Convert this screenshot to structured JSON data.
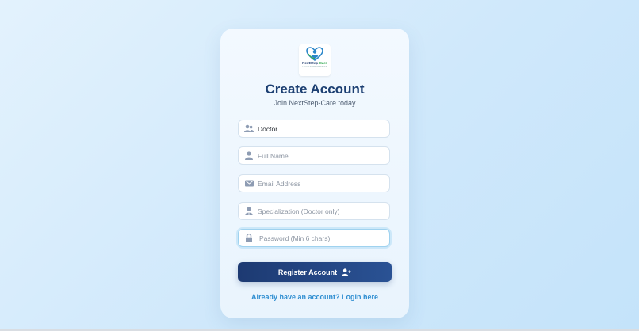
{
  "logo": {
    "brand_main": "NextStep",
    "brand_accent": "-Care",
    "tagline": "HEALTHCARE SERVICES",
    "icon": "heart-hands-icon"
  },
  "header": {
    "title": "Create Account",
    "subtitle": "Join NextStep-Care today"
  },
  "form": {
    "role": {
      "value": "Doctor",
      "icon": "users-icon"
    },
    "full_name": {
      "placeholder": "Full Name",
      "icon": "user-icon"
    },
    "email": {
      "placeholder": "Email Address",
      "icon": "envelope-icon"
    },
    "specialization": {
      "placeholder": "Specialization (Doctor only)",
      "icon": "user-doctor-icon"
    },
    "password": {
      "placeholder": "Password (Min 6 chars)",
      "icon": "lock-icon"
    }
  },
  "actions": {
    "register_label": "Register Account",
    "register_icon": "user-plus-icon",
    "login_link": "Already have an account? Login here"
  },
  "colors": {
    "primary": "#1d3a72",
    "link": "#2f8ed1",
    "title": "#1c3f72",
    "focus": "#9fd2ef"
  }
}
